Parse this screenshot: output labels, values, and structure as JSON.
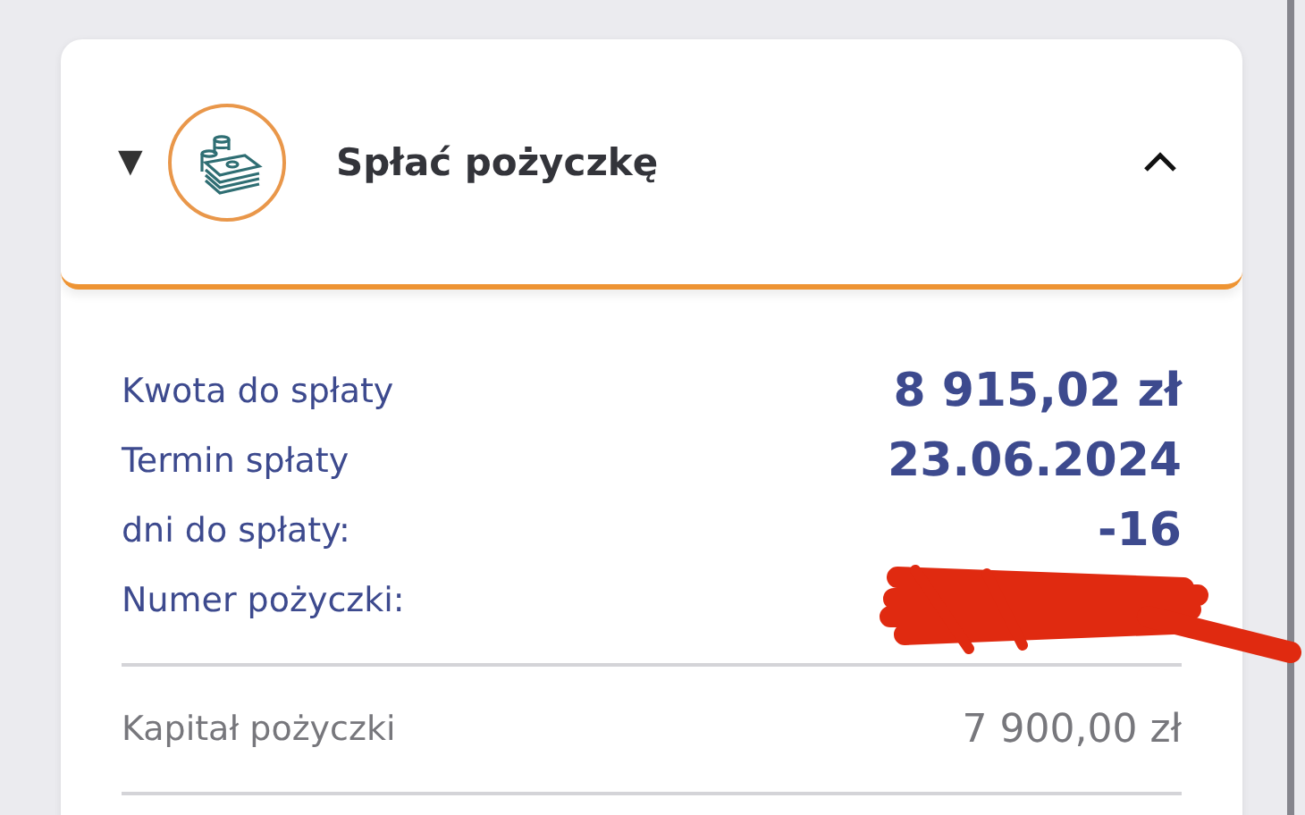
{
  "loan_panel": {
    "toggle": "▼",
    "title": "Spłać pożyczkę",
    "expanded": true,
    "details": [
      {
        "label": "Kwota do spłaty",
        "value": "8 915,02 zł"
      },
      {
        "label": "Termin spłaty",
        "value": "23.06.2024"
      },
      {
        "label": "dni do spłaty:",
        "value": "-16"
      },
      {
        "label": "Numer pożyczki:"
      }
    ],
    "summary": [
      {
        "label": "Kapitał pożyczki",
        "value": "7 900,00 zł"
      }
    ]
  }
}
